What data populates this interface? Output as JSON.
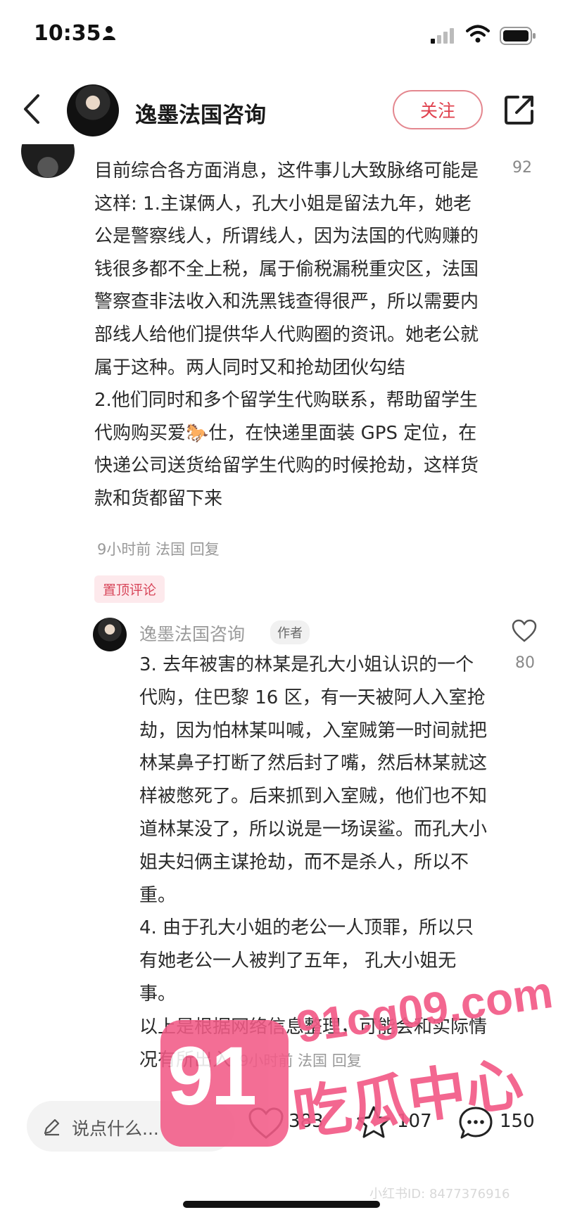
{
  "status_bar": {
    "time": "10:35"
  },
  "header": {
    "author": "逸墨法国咨询",
    "follow_label": "关注"
  },
  "comment": {
    "paragraphs": [
      "目前综合各方面消息，这件事儿大致脉络可能是这样: 1.主谋俩人，孔大小姐是留法九年，她老公是警察线人，所谓线人，因为法国的代购赚的钱很多都不全上税，属于偷税漏税重灾区，法国警察查非法收入和洗黑钱查得很严，所以需要内部线人给他们提供华人代购圈的资讯。她老公就属于这种。两人同时又和抢劫团伙勾结",
      "2.他们同时和多个留学生代购联系，帮助留学生代购购买爱🐎仕，在快递里面装 GPS 定位，在快递公司送货给留学生代购的时候抢劫，这样货款和货都留下来"
    ],
    "likes": "92",
    "meta": "9小时前  法国  回复",
    "pinned_label": "置顶评论"
  },
  "reply": {
    "author": "逸墨法国咨询",
    "author_tag": "作者",
    "likes": "80",
    "paragraphs": [
      "3. 去年被害的林某是孔大小姐认识的一个代购，住巴黎 16 区，有一天被阿人入室抢劫，因为怕林某叫喊，入室贼第一时间就把林某鼻子打断了然后封了嘴，然后林某就这样被憋死了。后来抓到入室贼，他们也不知道林某没了，所以说是一场误鲨。而孔大小姐夫妇俩主谋抢劫，而不是杀人，所以不重。",
      "4. 由于孔大小姐的老公一人顶罪，所以只有她老公一人被判了五年， 孔大小姐无事。"
    ],
    "last_line": "以上是根据网络信息整理，可能会和实际情况有所出入",
    "meta": "9小时前  法国  回复"
  },
  "bottom_bar": {
    "input_placeholder": "说点什么...",
    "like_count": "383",
    "star_count": "107",
    "comment_count": "150"
  },
  "watermark": {
    "logo": "91",
    "site": "91cg09.com",
    "name": "吃瓜中心"
  },
  "user_id": "小红书ID: 8477376916",
  "colors": {
    "accent": "#e0414e",
    "watermark": "#f25b87"
  }
}
